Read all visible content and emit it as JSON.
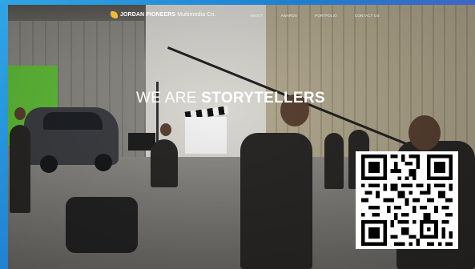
{
  "brand": {
    "name_bold": "JORDAN PIONEERS",
    "name_rest": " Multimedia Co."
  },
  "nav": {
    "items": [
      {
        "label": "ABOUT"
      },
      {
        "label": "AWARDS"
      },
      {
        "label": "PORTFOLIO"
      },
      {
        "label": "CONTACT US"
      }
    ]
  },
  "hero": {
    "headline_light": "WE ARE ",
    "headline_bold": "STORYTELLERS"
  },
  "colors": {
    "frame_accent": "#1f7fcf",
    "logo_mark": "#f4b83a",
    "greenscreen": "#63c33b"
  },
  "icons": {
    "logo": "jordan-pioneers-logo-icon",
    "qr": "qr-code"
  }
}
